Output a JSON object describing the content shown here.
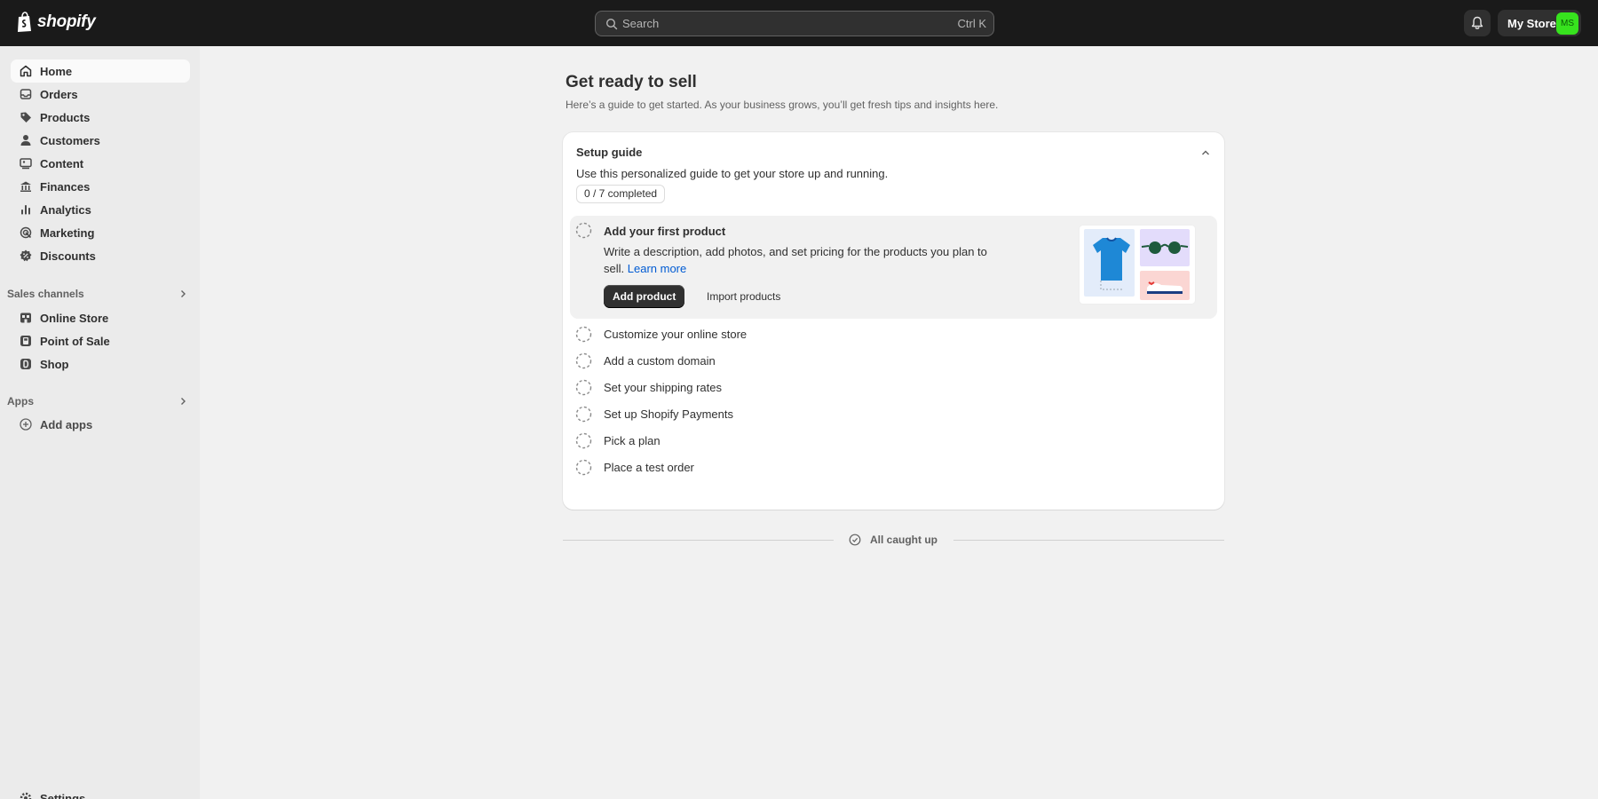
{
  "topbar": {
    "logo_text": "shopify",
    "search_placeholder": "Search",
    "search_shortcut": "Ctrl K",
    "store_name": "My Store",
    "avatar_initials": "MS",
    "avatar_color": "#37e31e"
  },
  "sidebar": {
    "main_items": [
      {
        "label": "Home",
        "icon": "home-icon",
        "active": true
      },
      {
        "label": "Orders",
        "icon": "orders-icon"
      },
      {
        "label": "Products",
        "icon": "tag-icon"
      },
      {
        "label": "Customers",
        "icon": "person-icon"
      },
      {
        "label": "Content",
        "icon": "content-icon"
      },
      {
        "label": "Finances",
        "icon": "bank-icon"
      },
      {
        "label": "Analytics",
        "icon": "bar-chart-icon"
      },
      {
        "label": "Marketing",
        "icon": "target-icon"
      },
      {
        "label": "Discounts",
        "icon": "discount-icon"
      }
    ],
    "sales_channels_label": "Sales channels",
    "sales_channels": [
      {
        "label": "Online Store",
        "icon": "store-icon"
      },
      {
        "label": "Point of Sale",
        "icon": "pos-icon"
      },
      {
        "label": "Shop",
        "icon": "shop-icon"
      }
    ],
    "apps_label": "Apps",
    "add_apps_label": "Add apps",
    "settings_label": "Settings"
  },
  "main": {
    "title": "Get ready to sell",
    "subtitle": "Here’s a guide to get started. As your business grows, you’ll get fresh tips and insights here."
  },
  "setup_guide": {
    "title": "Setup guide",
    "description": "Use this personalized guide to get your store up and running.",
    "progress": "0 / 7 completed",
    "expanded_task": {
      "title": "Add your first product",
      "description": "Write a description, add photos, and set pricing for the products you plan to sell.",
      "link": "Learn more",
      "primary_button": "Add product",
      "secondary_button": "Import products"
    },
    "tasks": [
      "Customize your online store",
      "Add a custom domain",
      "Set your shipping rates",
      "Set up Shopify Payments",
      "Pick a plan",
      "Place a test order"
    ]
  },
  "footer_status": "All caught up"
}
